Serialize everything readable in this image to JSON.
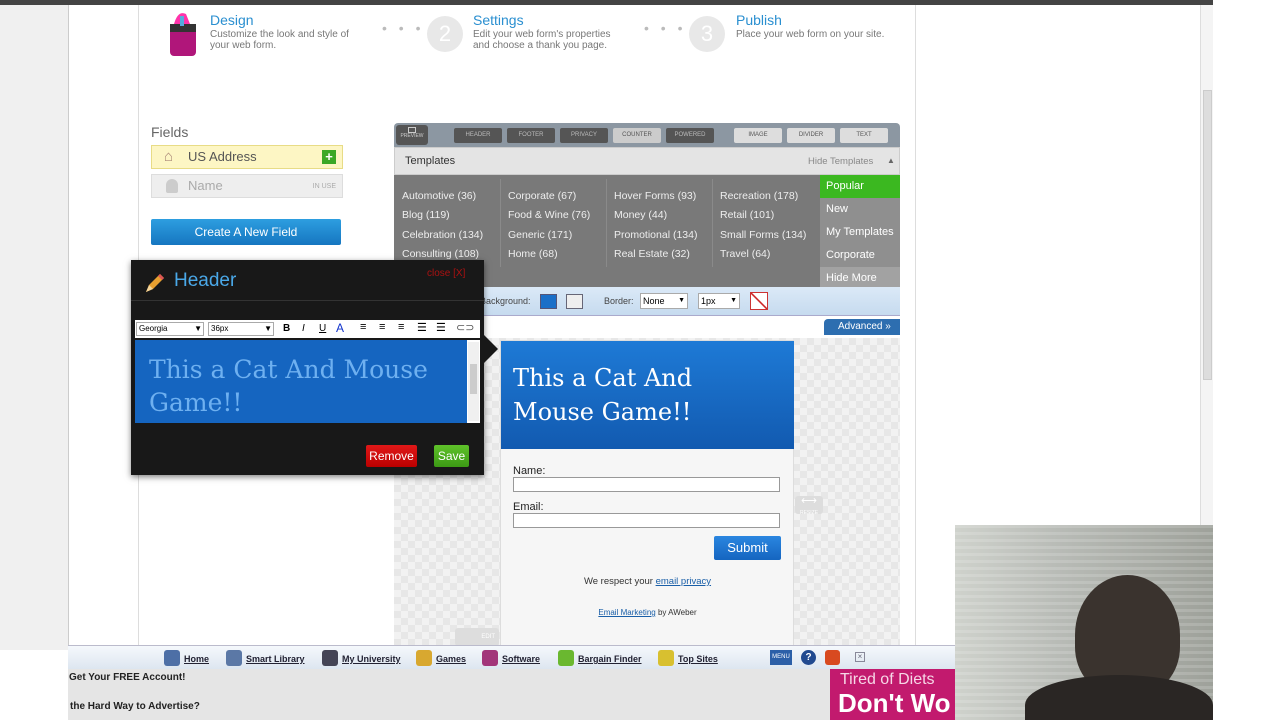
{
  "steps": [
    {
      "title": "Design",
      "desc": "Customize the look and style of your web form."
    },
    {
      "num": "2",
      "title": "Settings",
      "desc": "Edit your web form's properties and choose a thank you page."
    },
    {
      "num": "3",
      "title": "Publish",
      "desc": "Place your web form on your site."
    }
  ],
  "fields": {
    "title": "Fields",
    "items": [
      {
        "label": "US Address"
      },
      {
        "label": "Name",
        "badge": "IN USE"
      }
    ],
    "create_button": "Create A New Field"
  },
  "toolbar": {
    "preview": "PREVIEW",
    "items": [
      "HEADER",
      "FOOTER",
      "PRIVACY",
      "COUNTER",
      "POWERED",
      "IMAGE",
      "DIVIDER",
      "TEXT"
    ]
  },
  "templates": {
    "title": "Templates",
    "hide_label": "Hide Templates",
    "categories": [
      [
        "Automotive (36)",
        "Corporate (67)",
        "Hover Forms (93)",
        "Recreation (178)"
      ],
      [
        "Blog (119)",
        "Food & Wine (76)",
        "Money (44)",
        "Retail (101)"
      ],
      [
        "Celebration (134)",
        "Generic (171)",
        "Promotional (134)",
        "Small Forms (134)"
      ],
      [
        "Consulting (108)",
        "Home (68)",
        "Real Estate (32)",
        "Travel (64)"
      ]
    ],
    "side_menu": [
      "Popular",
      "New",
      "My Templates",
      "Corporate",
      "Hide More"
    ]
  },
  "style_bar": {
    "background_label": "Background:",
    "border_label": "Border:",
    "border_style": "None",
    "border_width": "1px",
    "advanced": "Advanced"
  },
  "header_editor": {
    "title": "Header",
    "close": "close [X]",
    "font": "Georgia",
    "size": "36px",
    "text": "This a Cat And Mouse Game!!",
    "remove": "Remove",
    "save": "Save"
  },
  "form_preview": {
    "heading": "This a Cat And Mouse Game!!",
    "name_label": "Name:",
    "email_label": "Email:",
    "submit": "Submit",
    "privacy_text": "We respect your",
    "privacy_link": "email privacy",
    "footer_link": "Email Marketing",
    "footer_text": "by AWeber",
    "resize": "RESIZE",
    "edit": "EDIT"
  },
  "bottom_bar": {
    "items": [
      "Home",
      "Smart Library",
      "My University",
      "Games",
      "Software",
      "Bargain Finder",
      "Top Sites"
    ],
    "menu": "MENU",
    "ad1": "Get Your FREE Account!",
    "ad2": "the Hard Way to Advertise?",
    "ad_banner1": "Tired of Diets",
    "ad_banner2": "Don't Wo"
  },
  "colors": {
    "accent": "#2a8fd0",
    "green": "#5cb82a",
    "remove_red": "#cc1111",
    "form_blue": "#1a6fc8"
  }
}
